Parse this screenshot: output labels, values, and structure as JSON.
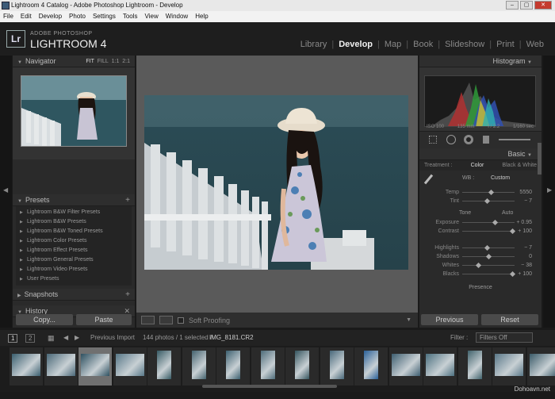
{
  "window": {
    "title": "Lightroom 4 Catalog - Adobe Photoshop Lightroom - Develop"
  },
  "menu": [
    "File",
    "Edit",
    "Develop",
    "Photo",
    "Settings",
    "Tools",
    "View",
    "Window",
    "Help"
  ],
  "brand": {
    "logo": "Lr",
    "top": "ADOBE PHOTOSHOP",
    "main": "LIGHTROOM 4"
  },
  "modules": [
    "Library",
    "Develop",
    "Map",
    "Book",
    "Slideshow",
    "Print",
    "Web"
  ],
  "active_module": "Develop",
  "navigator": {
    "title": "Navigator",
    "zoom": [
      "FIT",
      "FILL",
      "1:1",
      "2:1"
    ]
  },
  "presets": {
    "title": "Presets",
    "items": [
      "Lightroom B&W Filter Presets",
      "Lightroom B&W Presets",
      "Lightroom B&W Toned Presets",
      "Lightroom Color Presets",
      "Lightroom Effect Presets",
      "Lightroom General Presets",
      "Lightroom Video Presets",
      "User Presets"
    ]
  },
  "snapshots": {
    "title": "Snapshots"
  },
  "history": {
    "title": "History"
  },
  "left_buttons": {
    "copy": "Copy...",
    "paste": "Paste"
  },
  "toolbar": {
    "soft_proofing": "Soft Proofing"
  },
  "histogram": {
    "title": "Histogram",
    "iso": "ISO 100",
    "focal": "135 mm",
    "aperture": "f / 2.2",
    "shutter": "1/160 sec"
  },
  "basic": {
    "title": "Basic",
    "treatment_label": "Treatment :",
    "color": "Color",
    "bw": "Black & White",
    "wb_label": "WB :",
    "wb_value": "Custom",
    "tone_label": "Tone",
    "auto": "Auto",
    "presence": "Presence",
    "sliders_wb": [
      {
        "label": "Temp",
        "value": "5550",
        "pos": 0.55
      },
      {
        "label": "Tint",
        "value": "− 7",
        "pos": 0.47
      }
    ],
    "sliders_tone": [
      {
        "label": "Exposure",
        "value": "+ 0.95",
        "pos": 0.62
      },
      {
        "label": "Contrast",
        "value": "+ 100",
        "pos": 0.95
      }
    ],
    "sliders_tone2": [
      {
        "label": "Highlights",
        "value": "− 7",
        "pos": 0.47
      },
      {
        "label": "Shadows",
        "value": "0",
        "pos": 0.5
      },
      {
        "label": "Whites",
        "value": "− 38",
        "pos": 0.31
      },
      {
        "label": "Blacks",
        "value": "+ 100",
        "pos": 0.95
      }
    ]
  },
  "right_buttons": {
    "previous": "Previous",
    "reset": "Reset"
  },
  "filmstrip_bar": {
    "page1": "1",
    "page2": "2",
    "source": "Previous Import",
    "count": "144 photos / 1 selected /",
    "file": "IMG_8181.CR2",
    "filter_label": "Filter :",
    "filter_value": "Filters Off"
  },
  "watermark": "Dohoavn.net",
  "colors": {
    "panel": "#2a2a2a",
    "center": "#5a5a5a",
    "active_text": "#f0f0f0"
  }
}
